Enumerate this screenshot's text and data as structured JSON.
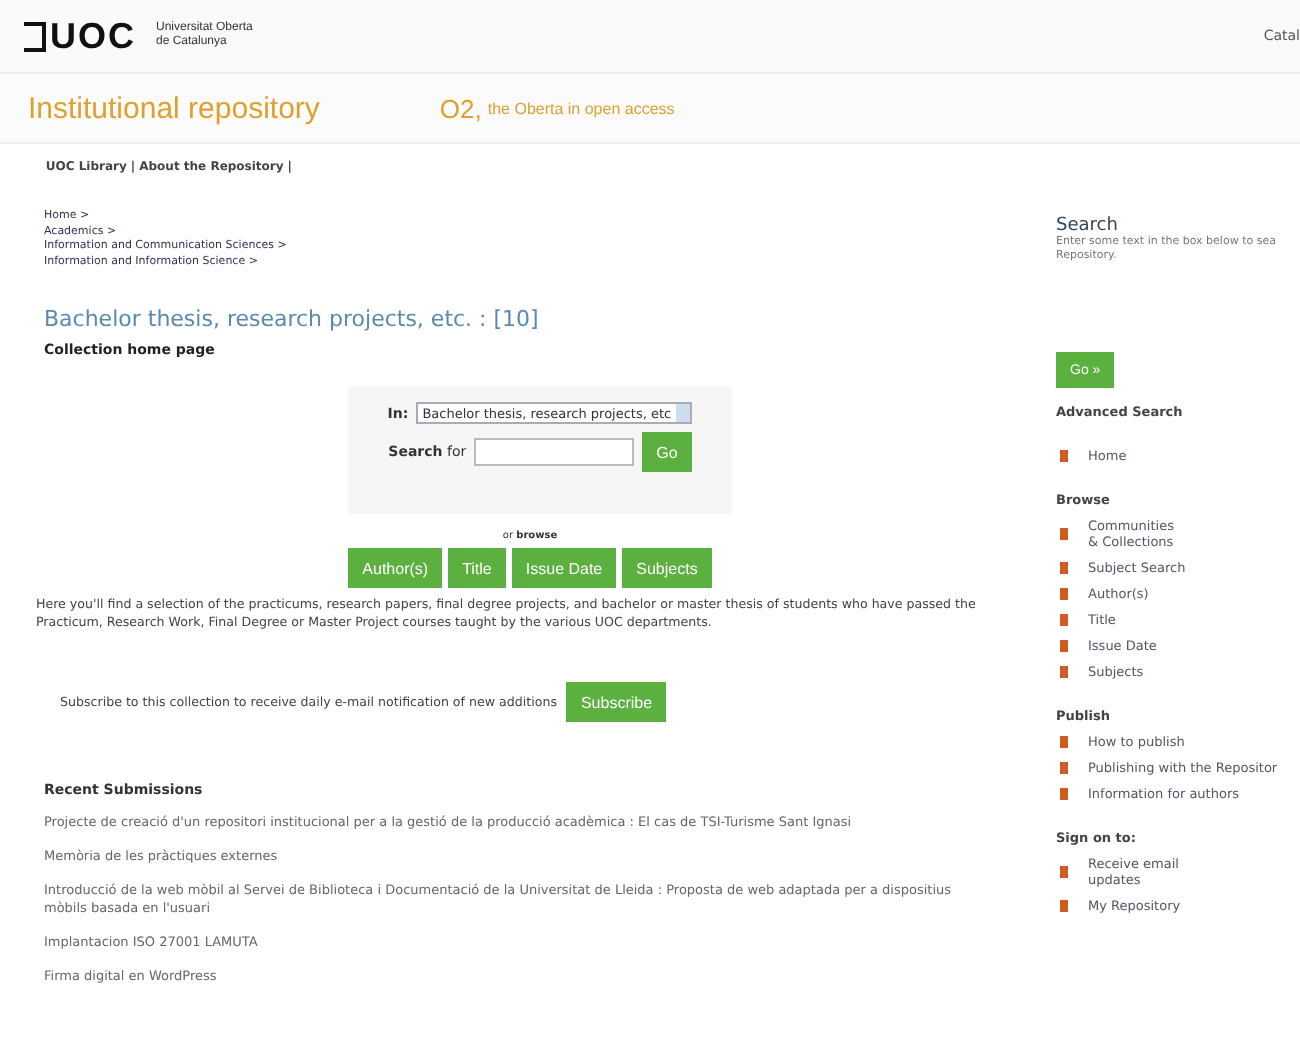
{
  "header": {
    "logo": "UOC",
    "university": [
      "Universitat Oberta",
      "de Catalunya"
    ],
    "language": "Catal"
  },
  "banner": {
    "title": "Institutional repository",
    "o2": "O2,",
    "tagline": "the Oberta in open access"
  },
  "top_links": [
    "UOC Library",
    "|",
    "About the Repository",
    "|"
  ],
  "breadcrumbs": [
    "Home >",
    "Academics >",
    "Information and Communication Sciences >",
    "Information and Information Science >"
  ],
  "heading": "Bachelor thesis, research projects, etc. : [10]",
  "subheading": "Collection home page",
  "search": {
    "in_label": "In:",
    "scope": "Bachelor thesis, research projects, etc",
    "search_label": "**Search** for",
    "go": "Go"
  },
  "browse": {
    "label": "or **browse**",
    "buttons": [
      "Author(s)",
      "Title",
      "Issue Date",
      "Subjects"
    ]
  },
  "description": "Here you'll find a selection of the practicums, research papers, final degree projects, and bachelor or master thesis of students who have passed the Practicum, Research Work, Final Degree or Master Project courses taught by the various UOC departments.",
  "subscribe": {
    "text": "Subscribe to this collection to receive daily e-mail notification of new additions",
    "button": "Subscribe"
  },
  "recent": {
    "title": "Recent Submissions",
    "items": [
      "Projecte de creació d'un repositori institucional per a la gestió de la producció acadèmica : El cas de TSI-Turisme Sant Ignasi",
      "Memòria de les pràctiques externes",
      "Introducció de la web mòbil al Servei de Biblioteca i Documentació de la Universitat de Lleida : Proposta de web adaptada per a dispositius mòbils basada en l'usuari",
      "Implantacion ISO 27001 LAMUTA",
      "Firma digital en WordPress"
    ]
  },
  "sidebar": {
    "search_title": "Search",
    "search_text": [
      "Enter some text in the box below to sea",
      "Repository."
    ],
    "go": "Go »",
    "advanced": "Advanced Search",
    "home": "Home",
    "sections": [
      {
        "title": "Browse",
        "items": [
          [
            "Communities",
            "& Collections"
          ],
          [
            "Subject Search"
          ],
          [
            "Author(s)"
          ],
          [
            "Title"
          ],
          [
            "Issue Date"
          ],
          [
            "Subjects"
          ]
        ]
      },
      {
        "title": "Publish",
        "items": [
          [
            "How to publish"
          ],
          [
            "Publishing with the Repositor"
          ],
          [
            "Information for authors"
          ]
        ]
      },
      {
        "title": "Sign on to:",
        "items": [
          [
            "Receive email",
            "updates"
          ],
          [
            "My Repository"
          ]
        ]
      }
    ]
  }
}
